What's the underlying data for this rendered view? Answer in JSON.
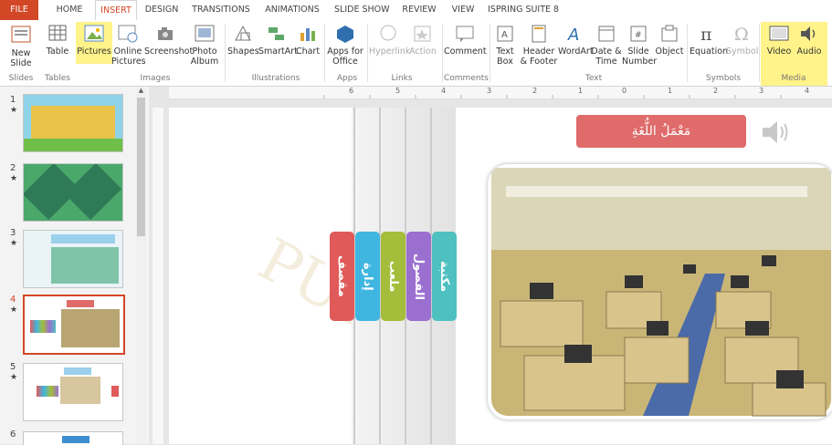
{
  "tabs": [
    "FILE",
    "HOME",
    "INSERT",
    "DESIGN",
    "TRANSITIONS",
    "ANIMATIONS",
    "SLIDE SHOW",
    "REVIEW",
    "VIEW",
    "ISPRING SUITE 8"
  ],
  "ribbon": {
    "new_slide": "New Slide",
    "table": "Table",
    "pictures": "Pictures",
    "online_pictures": "Online Pictures",
    "screenshot": "Screenshot",
    "photo_album": "Photo Album",
    "shapes": "Shapes",
    "smartart": "SmartArt",
    "chart": "Chart",
    "apps_for_office": "Apps for Office",
    "hyperlink": "Hyperlink",
    "action": "Action",
    "comment": "Comment",
    "text_box": "Text Box",
    "header_footer": "Header & Footer",
    "wordart": "WordArt",
    "date_time": "Date & Time",
    "slide_number": "Slide Number",
    "object": "Object",
    "equation": "Equation",
    "symbol": "Symbol",
    "video": "Video",
    "audio": "Audio",
    "groups": [
      "Slides",
      "Tables",
      "Images",
      "Illustrations",
      "Apps",
      "Links",
      "Comments",
      "Text",
      "Symbols",
      "Media"
    ]
  },
  "thumbnails": [
    {
      "num": "1",
      "star": "★"
    },
    {
      "num": "2",
      "star": "★"
    },
    {
      "num": "3",
      "star": "★"
    },
    {
      "num": "4",
      "star": "★"
    },
    {
      "num": "5",
      "star": "★"
    },
    {
      "num": "6",
      "star": ""
    }
  ],
  "ruler_labels": [
    "6",
    "5",
    "4",
    "3",
    "2",
    "1",
    "0",
    "1",
    "2",
    "3",
    "4"
  ],
  "slide": {
    "title": "مَعْمَلُ اللُّغَةِ",
    "book_tabs": [
      {
        "label": "مقصف",
        "color": "#e05a5a"
      },
      {
        "label": "إدارة",
        "color": "#3fb6e0"
      },
      {
        "label": "ملعب",
        "color": "#a4bd3a"
      },
      {
        "label": "الفصول",
        "color": "#9b6fcf"
      },
      {
        "label": "مكتبة",
        "color": "#4fc0c0"
      }
    ]
  },
  "colors": {
    "accent": "#d24726",
    "highlight": "#fff176"
  }
}
